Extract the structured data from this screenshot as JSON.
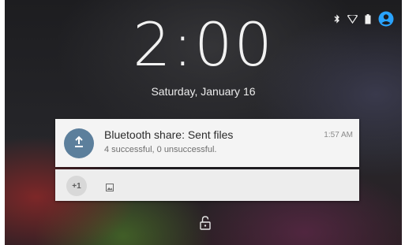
{
  "status_bar": {
    "icons": [
      "bluetooth-icon",
      "wifi-icon",
      "battery-icon",
      "user-account-icon"
    ],
    "accent": "#29a3ff"
  },
  "lockscreen": {
    "time": "2:00",
    "date": "Saturday, January 16"
  },
  "notification": {
    "icon": "upload-icon",
    "title": "Bluetooth share: Sent files",
    "text": "4 successful, 0 unsuccessful.",
    "time": "1:57 AM",
    "avatar_color": "#5c7f9c"
  },
  "more_notifications": {
    "count_label": "+1",
    "icon": "image-icon"
  },
  "unlock": {
    "icon": "lock-open-icon"
  }
}
